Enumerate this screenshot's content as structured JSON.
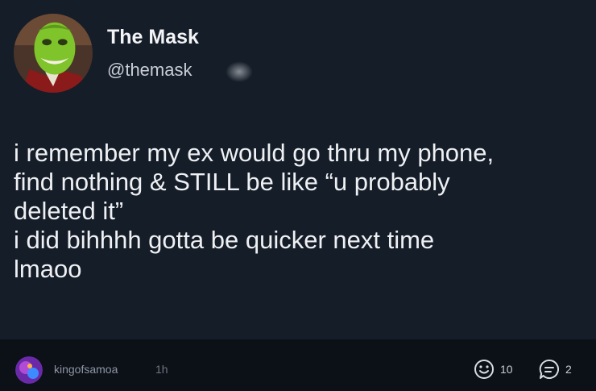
{
  "post": {
    "display_name": "The Mask",
    "handle": "@themask",
    "avatar_icon": "green-mask-face-avatar",
    "lines": [
      "i remember my ex would go thru my phone,",
      "find nothing & STILL be like “u probably",
      "deleted it”",
      "i did bihhhh gotta be quicker next time",
      "lmaoo"
    ]
  },
  "footer": {
    "username": "kingofsamoa",
    "time": "1h",
    "reactions_count": "10",
    "replies_count": "2",
    "icons": [
      "smiley-icon",
      "comment-icon"
    ]
  },
  "colors": {
    "background": "#151d28",
    "footer_background": "#0c1118",
    "text": "#eef0f3",
    "muted": "#8f96a3"
  }
}
